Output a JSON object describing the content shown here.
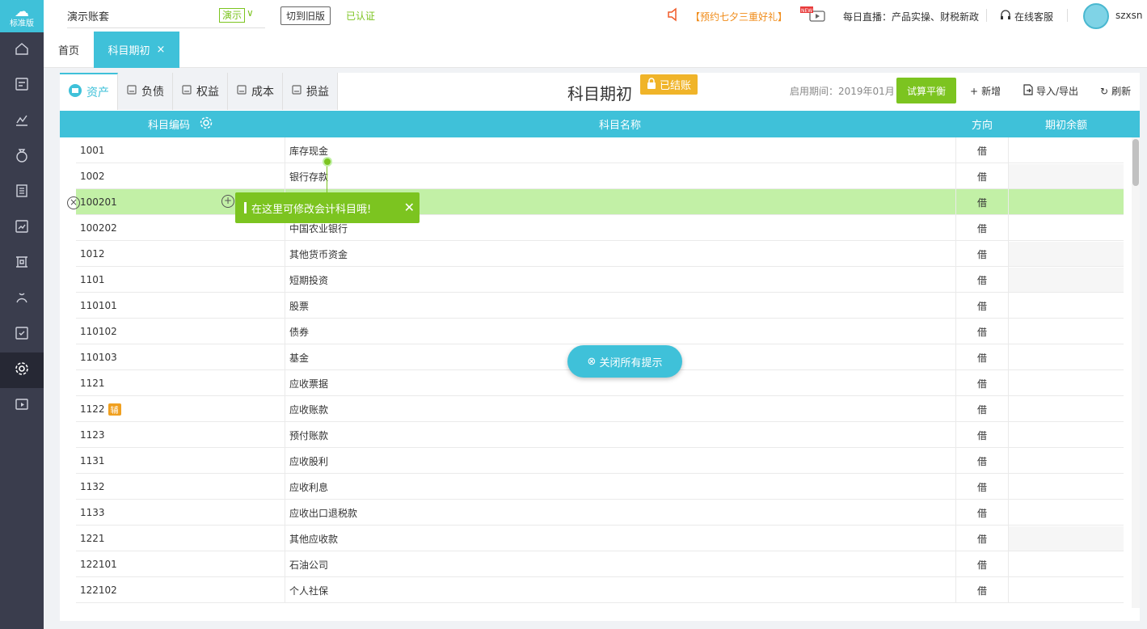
{
  "brand": {
    "label": "标准版"
  },
  "sidebar": {
    "items": [
      {
        "icon": "home-icon"
      },
      {
        "icon": "voucher-icon"
      },
      {
        "icon": "chart-icon"
      },
      {
        "icon": "money-bag-icon"
      },
      {
        "icon": "ledger-icon"
      },
      {
        "icon": "report-icon"
      },
      {
        "icon": "asset-icon"
      },
      {
        "icon": "payroll-icon"
      },
      {
        "icon": "invoice-icon"
      },
      {
        "icon": "settings-icon",
        "active": true
      },
      {
        "icon": "video-icon"
      }
    ]
  },
  "topbar": {
    "account": "演示账套",
    "demo_tag": "演示",
    "old_version": "切到旧版",
    "verified": "已认证",
    "promo": "【预约七夕三重好礼】",
    "new_badge": "NEW",
    "live": "每日直播：产品实操、财税新政",
    "service": "在线客服",
    "user": "szxsn"
  },
  "tabs": {
    "home": "首页",
    "active": "科目期初",
    "close": "×"
  },
  "categories": [
    {
      "label": "资产",
      "active": true
    },
    {
      "label": "负债"
    },
    {
      "label": "权益"
    },
    {
      "label": "成本"
    },
    {
      "label": "损益"
    }
  ],
  "header": {
    "title": "科目期初",
    "closed": "已结账",
    "period": "启用期间：2019年01月",
    "trial": "试算平衡",
    "add": "新增",
    "import_export": "导入/导出",
    "refresh": "刷新"
  },
  "table": {
    "columns": {
      "code": "科目编码",
      "name": "科目名称",
      "direction": "方向",
      "balance": "期初余额"
    },
    "rows": [
      {
        "code": "1001",
        "name": "库存现金",
        "dir": "借"
      },
      {
        "code": "1002",
        "name": "银行存款",
        "dir": "借"
      },
      {
        "code": "100201",
        "name": "",
        "dir": "借",
        "highlight": true
      },
      {
        "code": "100202",
        "name": "中国农业银行",
        "dir": "借"
      },
      {
        "code": "1012",
        "name": "其他货币资金",
        "dir": "借"
      },
      {
        "code": "1101",
        "name": "短期投资",
        "dir": "借"
      },
      {
        "code": "110101",
        "name": "股票",
        "dir": "借"
      },
      {
        "code": "110102",
        "name": "债券",
        "dir": "借"
      },
      {
        "code": "110103",
        "name": "基金",
        "dir": "借"
      },
      {
        "code": "1121",
        "name": "应收票据",
        "dir": "借"
      },
      {
        "code": "1122",
        "name": "应收账款",
        "dir": "借",
        "aux": "辅"
      },
      {
        "code": "1123",
        "name": "预付账款",
        "dir": "借"
      },
      {
        "code": "1131",
        "name": "应收股利",
        "dir": "借"
      },
      {
        "code": "1132",
        "name": "应收利息",
        "dir": "借"
      },
      {
        "code": "1133",
        "name": "应收出口退税款",
        "dir": "借"
      },
      {
        "code": "1221",
        "name": "其他应收款",
        "dir": "借"
      },
      {
        "code": "122101",
        "name": "石油公司",
        "dir": "借"
      },
      {
        "code": "122102",
        "name": "个人社保",
        "dir": "借"
      }
    ]
  },
  "tip": {
    "text": "在这里可修改会计科目哦!",
    "close": "✕"
  },
  "close_all": "关闭所有提示",
  "colors": {
    "accent": "#3fc1d9",
    "green": "#7cc420",
    "sidebar": "#3a3d4d",
    "badge": "#f0b429"
  }
}
